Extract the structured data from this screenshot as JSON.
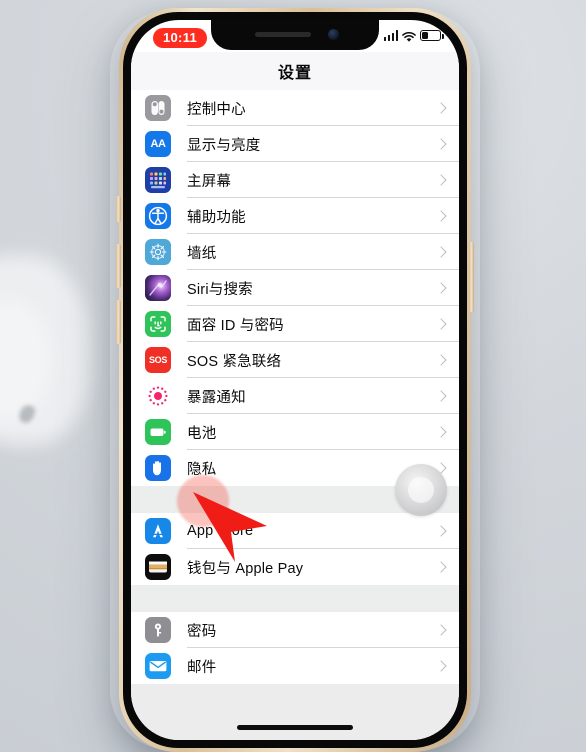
{
  "device": {
    "status_bar": {
      "time": "10:11",
      "time_badge_color": "#ff2d20",
      "signal_icon": "cellular-signal-icon",
      "wifi_icon": "wifi-icon",
      "battery_icon": "battery-low-icon"
    },
    "home_indicator": "home-indicator"
  },
  "nav": {
    "title": "设置"
  },
  "groups": [
    {
      "rows": [
        {
          "label": "控制中心",
          "icon": "control-center-icon"
        },
        {
          "label": "显示与亮度",
          "icon": "display-brightness-icon",
          "glyph": "AA"
        },
        {
          "label": "主屏幕",
          "icon": "home-screen-icon"
        },
        {
          "label": "辅助功能",
          "icon": "accessibility-icon"
        },
        {
          "label": "墙纸",
          "icon": "wallpaper-icon"
        },
        {
          "label": "Siri与搜索",
          "icon": "siri-search-icon"
        },
        {
          "label": "面容 ID 与密码",
          "icon": "face-id-icon"
        },
        {
          "label": "SOS 紧急联络",
          "icon": "emergency-sos-icon",
          "glyph": "SOS"
        },
        {
          "label": "暴露通知",
          "icon": "exposure-notification-icon"
        },
        {
          "label": "电池",
          "icon": "battery-settings-icon"
        },
        {
          "label": "隐私",
          "icon": "privacy-icon"
        }
      ]
    },
    {
      "rows": [
        {
          "label": "App Store",
          "icon": "app-store-icon"
        },
        {
          "label": "钱包与 Apple Pay",
          "icon": "wallet-apple-pay-icon"
        }
      ]
    },
    {
      "rows": [
        {
          "label": "密码",
          "icon": "passwords-icon"
        },
        {
          "label": "邮件",
          "icon": "mail-icon"
        }
      ]
    }
  ],
  "overlays": {
    "assistive_touch": "assistive-touch-button",
    "tap_highlight": "tap-highlight-indicator",
    "tap_highlight_color": "#f44336",
    "cursor": "cursor-arrow",
    "cursor_color": "#f01c16",
    "tapped_row_label": "隐私"
  }
}
